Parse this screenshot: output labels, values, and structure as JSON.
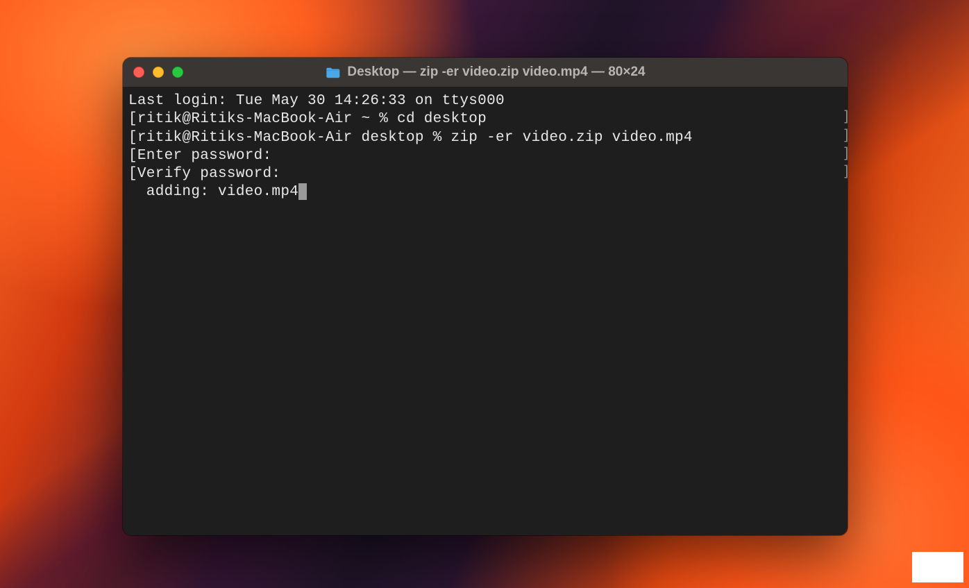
{
  "window": {
    "title": "Desktop — zip -er video.zip video.mp4 — 80×24",
    "folder_icon": "folder-icon"
  },
  "terminal": {
    "lines": [
      "Last login: Tue May 30 14:26:33 on ttys000",
      "[ritik@Ritiks-MacBook-Air ~ % cd desktop",
      "[ritik@Ritiks-MacBook-Air desktop % zip -er video.zip video.mp4",
      "[Enter password: ",
      "[Verify password: ",
      "  adding: video.mp4"
    ],
    "right_marks": [
      "]",
      "]",
      "]",
      "]"
    ]
  },
  "colors": {
    "window_bg": "#1e1e1e",
    "titlebar_bg": "#3a3634",
    "text": "#e8e8e8",
    "close": "#ff5f57",
    "minimize": "#febc2e",
    "maximize": "#28c840"
  }
}
